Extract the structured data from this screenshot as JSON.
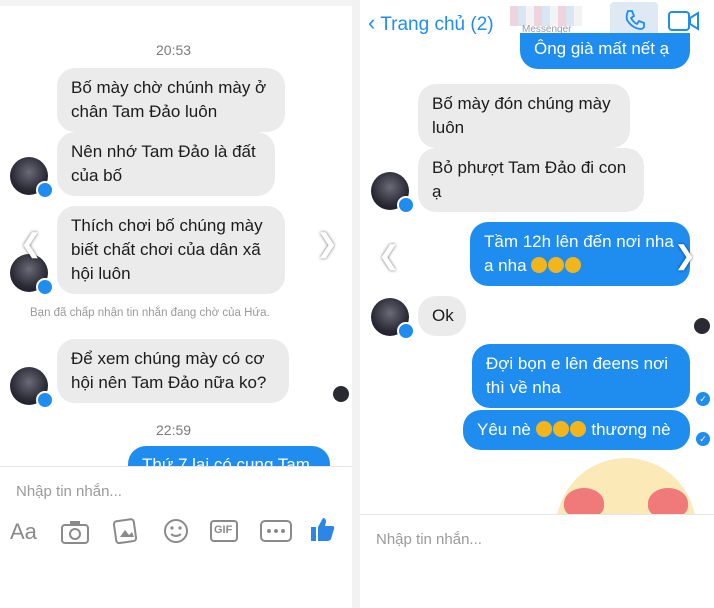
{
  "left": {
    "time1": "20:53",
    "messages": [
      {
        "text": "Bố mày chờ chúnh mày ở chân Tam Đảo luôn"
      },
      {
        "text": "Nên nhớ Tam Đảo là đất của bố"
      },
      {
        "text": "Thích chơi bố chúng mày biết chất chơi của dân xã hội luôn"
      },
      {
        "text": "Để xem chúng mày có cơ hội nên Tam Đảo nữa ko?"
      }
    ],
    "system_notice": "Bạn đã chấp nhận tin nhắn đang chờ của Hứa.",
    "time2": "22:59",
    "partial_out": "Thứ 7 lại có cung Tam",
    "input_placeholder": "Nhập tin nhắn...",
    "toolbar": {
      "aa_label": "Aa",
      "gif_label": "GIF"
    }
  },
  "right": {
    "header": {
      "back_label": "Trang chủ (2)",
      "subtitle": "Messenger"
    },
    "out_top": "Ông già mất nết ạ",
    "in_messages": [
      {
        "text": "Bố mày đón chúng mày luôn"
      },
      {
        "text": "Bỏ phượt Tam Đảo đi con ạ"
      }
    ],
    "out1_text": "Tầm 12h lên đến nơi nha a nha",
    "in_ok": "Ok",
    "out2": "Đợi bọn e lên  đeens nơi thì về nha",
    "out3_pre": "Yêu nè",
    "out3_post": "thương nè",
    "input_placeholder": "Nhập tin nhắn..."
  },
  "colors": {
    "accent": "#1f8df0",
    "incoming": "#ebebeb"
  }
}
